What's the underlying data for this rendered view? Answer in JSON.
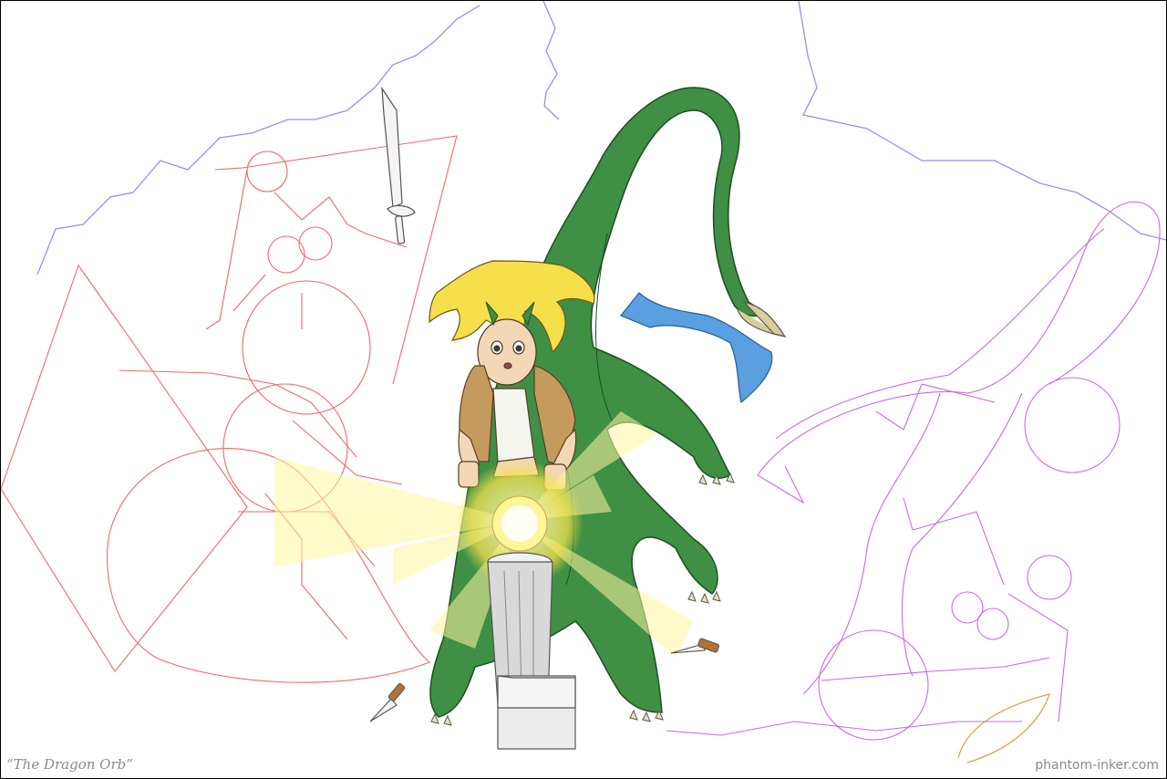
{
  "artwork": {
    "title": "“The Dragon Orb”",
    "credit": "phantom-inker.com",
    "colors": {
      "dragon": "#3f8f45",
      "dragon_outline": "#1f4f23",
      "hair": "#f5df4a",
      "jacket": "#c59a5d",
      "skin": "#f3d7b6",
      "scarf": "#5a9fe0",
      "orb_glow": "#fff38a",
      "red_sketch": "#ef6a6a",
      "purple_sketch": "#c86de0",
      "lightning": "#8f95e8",
      "pillar": "#d9d9d9"
    },
    "icons": [
      "sword-icon",
      "dagger-icon",
      "orb-icon",
      "pillar-icon"
    ]
  }
}
